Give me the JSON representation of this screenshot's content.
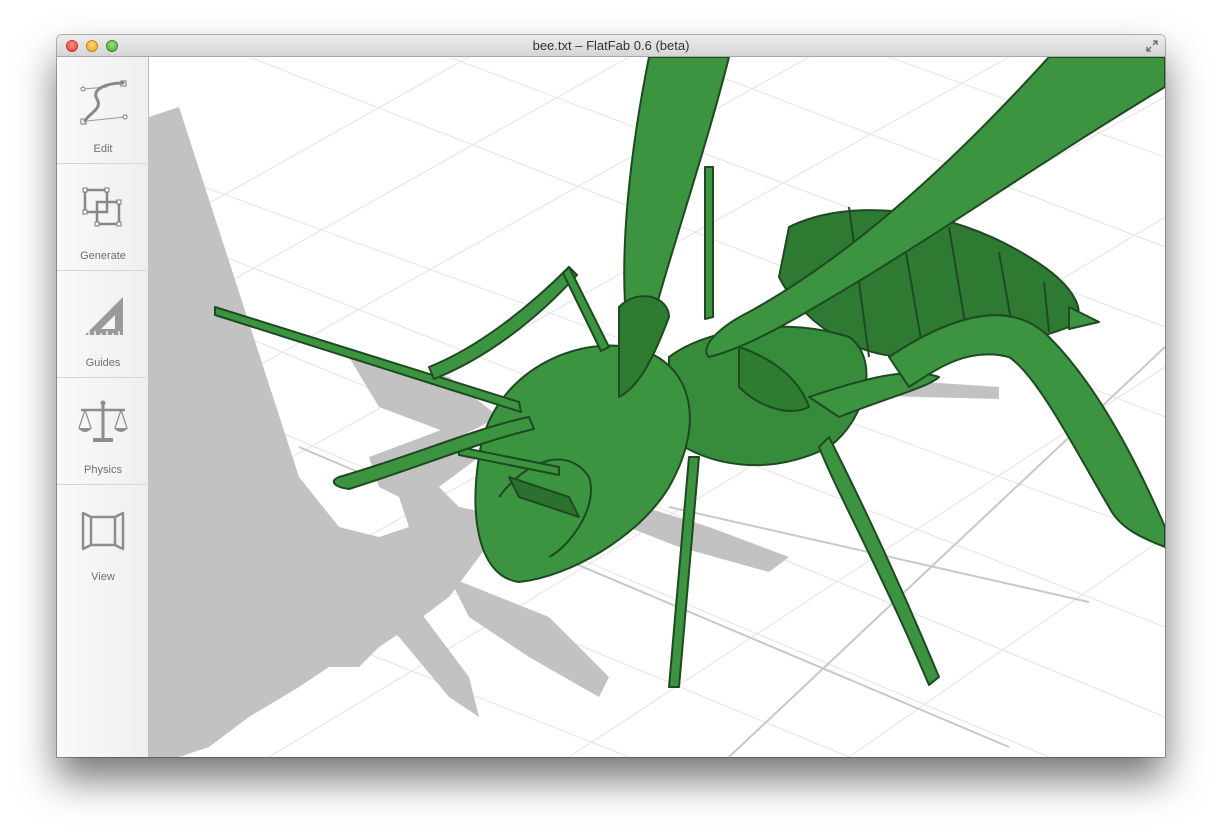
{
  "window": {
    "title": "bee.txt – FlatFab 0.6 (beta)"
  },
  "sidebar": {
    "tools": [
      {
        "label": "Edit",
        "icon": "bezier-curve-icon"
      },
      {
        "label": "Generate",
        "icon": "generate-squares-icon"
      },
      {
        "label": "Guides",
        "icon": "set-square-ruler-icon"
      },
      {
        "label": "Physics",
        "icon": "balance-scale-icon"
      },
      {
        "label": "View",
        "icon": "view-box-icon"
      }
    ]
  },
  "viewport": {
    "model_color": "#3c9440",
    "model_edge_color": "#1e4a21",
    "shadow_color": "#c2c2c2",
    "grid_color": "#e3e3e3"
  }
}
